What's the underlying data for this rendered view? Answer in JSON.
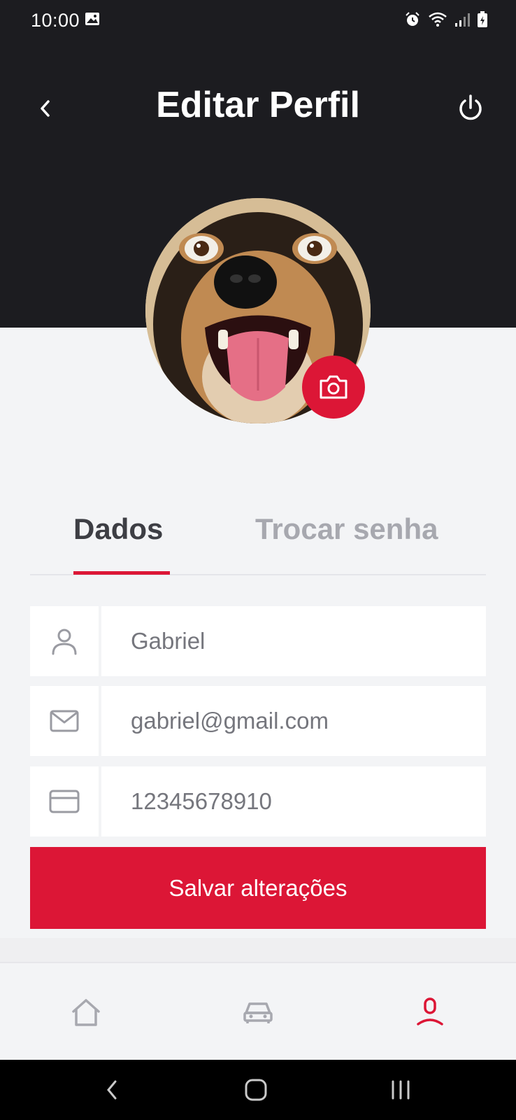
{
  "status_bar": {
    "time": "10:00",
    "icons": [
      "gallery-icon",
      "alarm-icon",
      "wifi-icon",
      "signal-icon",
      "battery-icon"
    ]
  },
  "header": {
    "title": "Editar Perfil",
    "back_icon": "chevron-left-icon",
    "logout_icon": "power-icon",
    "background_color": "#1c1c20"
  },
  "profile": {
    "avatar_alt": "dog-photo",
    "camera_icon": "camera-icon"
  },
  "tabs": [
    {
      "label": "Dados",
      "active": true
    },
    {
      "label": "Trocar senha",
      "active": false
    }
  ],
  "form": {
    "name": {
      "icon": "user-icon",
      "value": "Gabriel"
    },
    "email": {
      "icon": "mail-icon",
      "value": "gabriel@gmail.com"
    },
    "document": {
      "icon": "card-icon",
      "value": "12345678910"
    },
    "save_label": "Salvar alterações"
  },
  "bottom_nav": [
    {
      "icon": "home-icon",
      "active": false
    },
    {
      "icon": "car-icon",
      "active": false
    },
    {
      "icon": "profile-icon",
      "active": true
    }
  ],
  "system_nav": [
    "back",
    "home",
    "recents"
  ],
  "colors": {
    "accent": "#dc1636",
    "dark": "#1c1c20",
    "background": "#f3f4f6",
    "inactive": "#a7a8af"
  }
}
